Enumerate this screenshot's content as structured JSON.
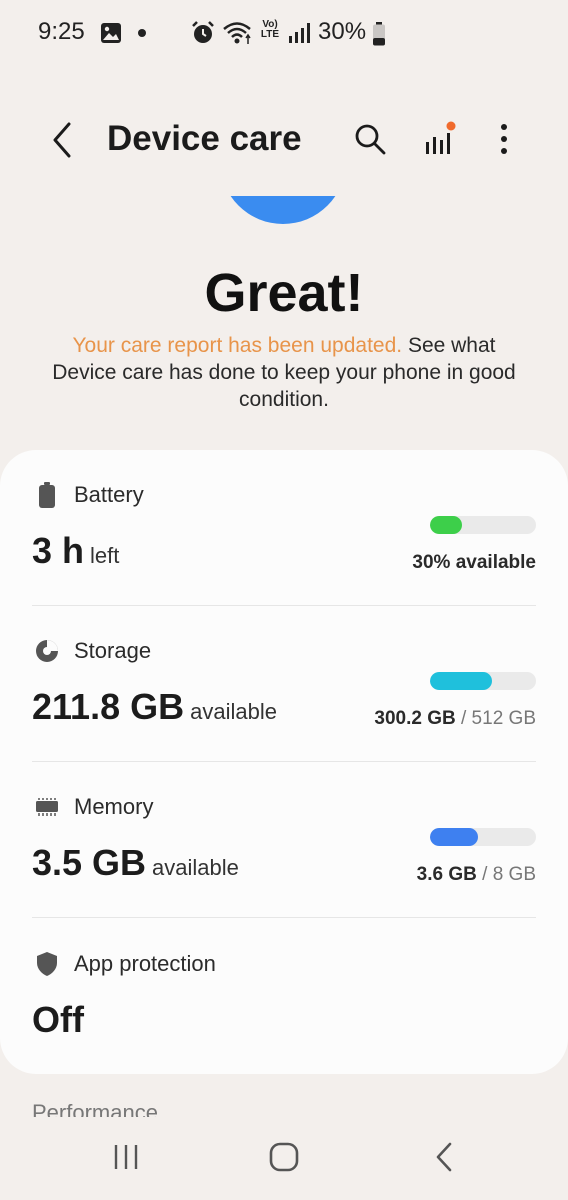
{
  "status_bar": {
    "time": "9:25",
    "volte_top": "Vo)",
    "volte_bottom": "LTE",
    "battery_percent": "30%"
  },
  "app_bar": {
    "title": "Device care",
    "back_icon": "chevron-left-icon",
    "search_icon": "search-icon",
    "stats_icon": "bar-chart-icon",
    "more_icon": "more-vertical-icon"
  },
  "hero": {
    "title": "Great!",
    "desc_accent": "Your care report has been updated.",
    "desc_rest": " See what Device care has done to keep your phone in good condition."
  },
  "items": {
    "battery": {
      "label": "Battery",
      "value": "3 h",
      "value_suffix": "left",
      "meta_bold": "30% available",
      "level": 0.3,
      "color": "#3dcf4a"
    },
    "storage": {
      "label": "Storage",
      "value": "211.8 GB",
      "value_suffix": "available",
      "meta_bold": "300.2 GB",
      "meta_light": " / 512 GB",
      "level": 0.586,
      "color": "#1fc0dc"
    },
    "memory": {
      "label": "Memory",
      "value": "3.5 GB",
      "value_suffix": "available",
      "meta_bold": "3.6 GB",
      "meta_light": " / 8 GB",
      "level": 0.45,
      "color": "#3e80f0"
    },
    "app_protection": {
      "label": "App protection",
      "value": "Off"
    }
  },
  "next_section": {
    "label": "Performance"
  },
  "colors": {
    "background": "#f3efec",
    "accent": "#e8944a",
    "hero_arc": "#3a8cf0",
    "notification_dot": "#f06a2c"
  }
}
